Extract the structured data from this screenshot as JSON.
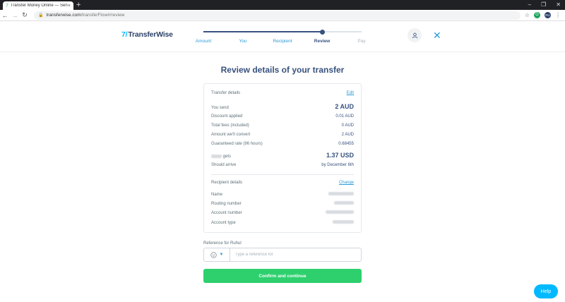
{
  "browser": {
    "tab_title": "Transfer Money Online — Send",
    "tab_close": "×",
    "new_tab": "+",
    "url_host": "transferwise.com",
    "url_path": "/transferFlow#/review",
    "profile_initials": "RU",
    "window_controls": [
      "–",
      "❐",
      "✕"
    ]
  },
  "header": {
    "logo_mark": "7/",
    "logo_text": "TransferWise",
    "steps": [
      {
        "label": "Amount",
        "state": "done"
      },
      {
        "label": "You",
        "state": "done"
      },
      {
        "label": "Recipient",
        "state": "done"
      },
      {
        "label": "Review",
        "state": "current"
      },
      {
        "label": "Pay",
        "state": "todo"
      }
    ],
    "progress_step_index": 3
  },
  "main": {
    "title": "Review details of your transfer",
    "transfer_details": {
      "heading": "Transfer details",
      "edit_label": "Edit",
      "rows": [
        {
          "label": "You send",
          "value": "2 AUD",
          "big": true
        },
        {
          "label": "Discount applied",
          "value": "0.01 AUD"
        },
        {
          "label": "Total fees (included)",
          "value": "0 AUD"
        },
        {
          "label": "Amount we'll convert",
          "value": "2 AUD"
        },
        {
          "label": "Guaranteed rate (96 hours)",
          "value": "0.68455"
        },
        {
          "label": "gets",
          "value": "1.37 USD",
          "big": true
        },
        {
          "label": "Should arrive",
          "value": "by December 6th"
        }
      ]
    },
    "recipient_details": {
      "heading": "Recipient details",
      "change_label": "Change",
      "rows": [
        {
          "label": "Name"
        },
        {
          "label": "Routing number"
        },
        {
          "label": "Account number"
        },
        {
          "label": "Account type"
        }
      ]
    },
    "reference": {
      "label": "Reference for Ruhul",
      "placeholder": "Type a reference for"
    },
    "confirm_label": "Confirm and continue",
    "help_label": "Help"
  },
  "colors": {
    "primary_text": "#37517e",
    "accent_blue": "#2c9bd6",
    "confirm_green": "#2ed06e",
    "help_blue": "#00b9ff"
  }
}
